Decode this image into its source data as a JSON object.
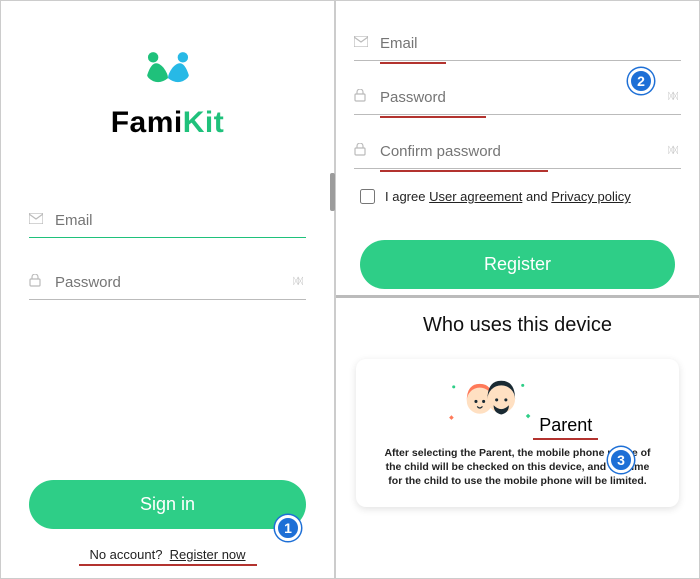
{
  "brand": {
    "fami": "Fami",
    "kit": "Kit"
  },
  "colors": {
    "accent": "#2ece87",
    "annotation": "#b3332f",
    "callout": "#1d6fd6"
  },
  "left": {
    "email": {
      "value": "",
      "placeholder": "Email"
    },
    "password": {
      "value": "",
      "placeholder": "Password"
    },
    "signin": "Sign in",
    "noacct": "No account?",
    "register_now": "Register now"
  },
  "reg": {
    "email": {
      "value": "",
      "placeholder": "Email"
    },
    "password": {
      "value": "",
      "placeholder": "Password"
    },
    "confirm": {
      "value": "",
      "placeholder": "Confirm password"
    },
    "agree_pre": "I agree",
    "agree_ua": "User agreement",
    "agree_and": "and",
    "agree_pp": "Privacy policy",
    "register": "Register"
  },
  "device": {
    "title": "Who uses this device",
    "role": "Parent",
    "desc": "After selecting the Parent, the mobile phone usage of the child will be checked on this device, and the time for the child to use the mobile phone will be limited."
  },
  "callouts": {
    "one": "1",
    "two": "2",
    "three": "3"
  },
  "icons": {
    "email": "envelope-icon",
    "lock": "lock-icon",
    "toggle": "password-toggle-icon"
  }
}
